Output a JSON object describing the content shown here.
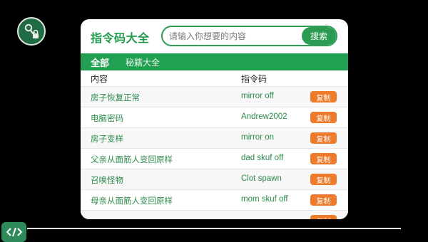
{
  "app": {
    "logo_text": "指令码大全"
  },
  "search": {
    "placeholder": "请输入你想要的内容",
    "button_label": "搜索"
  },
  "tabs": [
    {
      "label": "全部",
      "active": true
    },
    {
      "label": "秘籍大全",
      "active": false
    }
  ],
  "table": {
    "headers": {
      "content": "内容",
      "code": "指令码"
    },
    "rows": [
      {
        "name": "房子恢复正常",
        "code": "mirror off",
        "copy": "复制"
      },
      {
        "name": "电脑密码",
        "code": "Andrew2002",
        "copy": "复制"
      },
      {
        "name": "房子变样",
        "code": "mirror on",
        "copy": "复制"
      },
      {
        "name": "父亲从面筋人变回原样",
        "code": "dad skuf off",
        "copy": "复制"
      },
      {
        "name": "召唤怪物",
        "code": "Clot spawn",
        "copy": "复制"
      },
      {
        "name": "母亲从面筋人变回原样",
        "code": "mom skuf off",
        "copy": "复制"
      },
      {
        "name": "",
        "code": "",
        "copy": "复制"
      }
    ]
  },
  "icons": {
    "floating_top": "key-lock-icon",
    "floating_bottom": "code-brackets-icon"
  },
  "colors": {
    "brand_green": "#22a052",
    "copy_orange": "#f07a2c",
    "text_green": "#2c8a4a"
  }
}
